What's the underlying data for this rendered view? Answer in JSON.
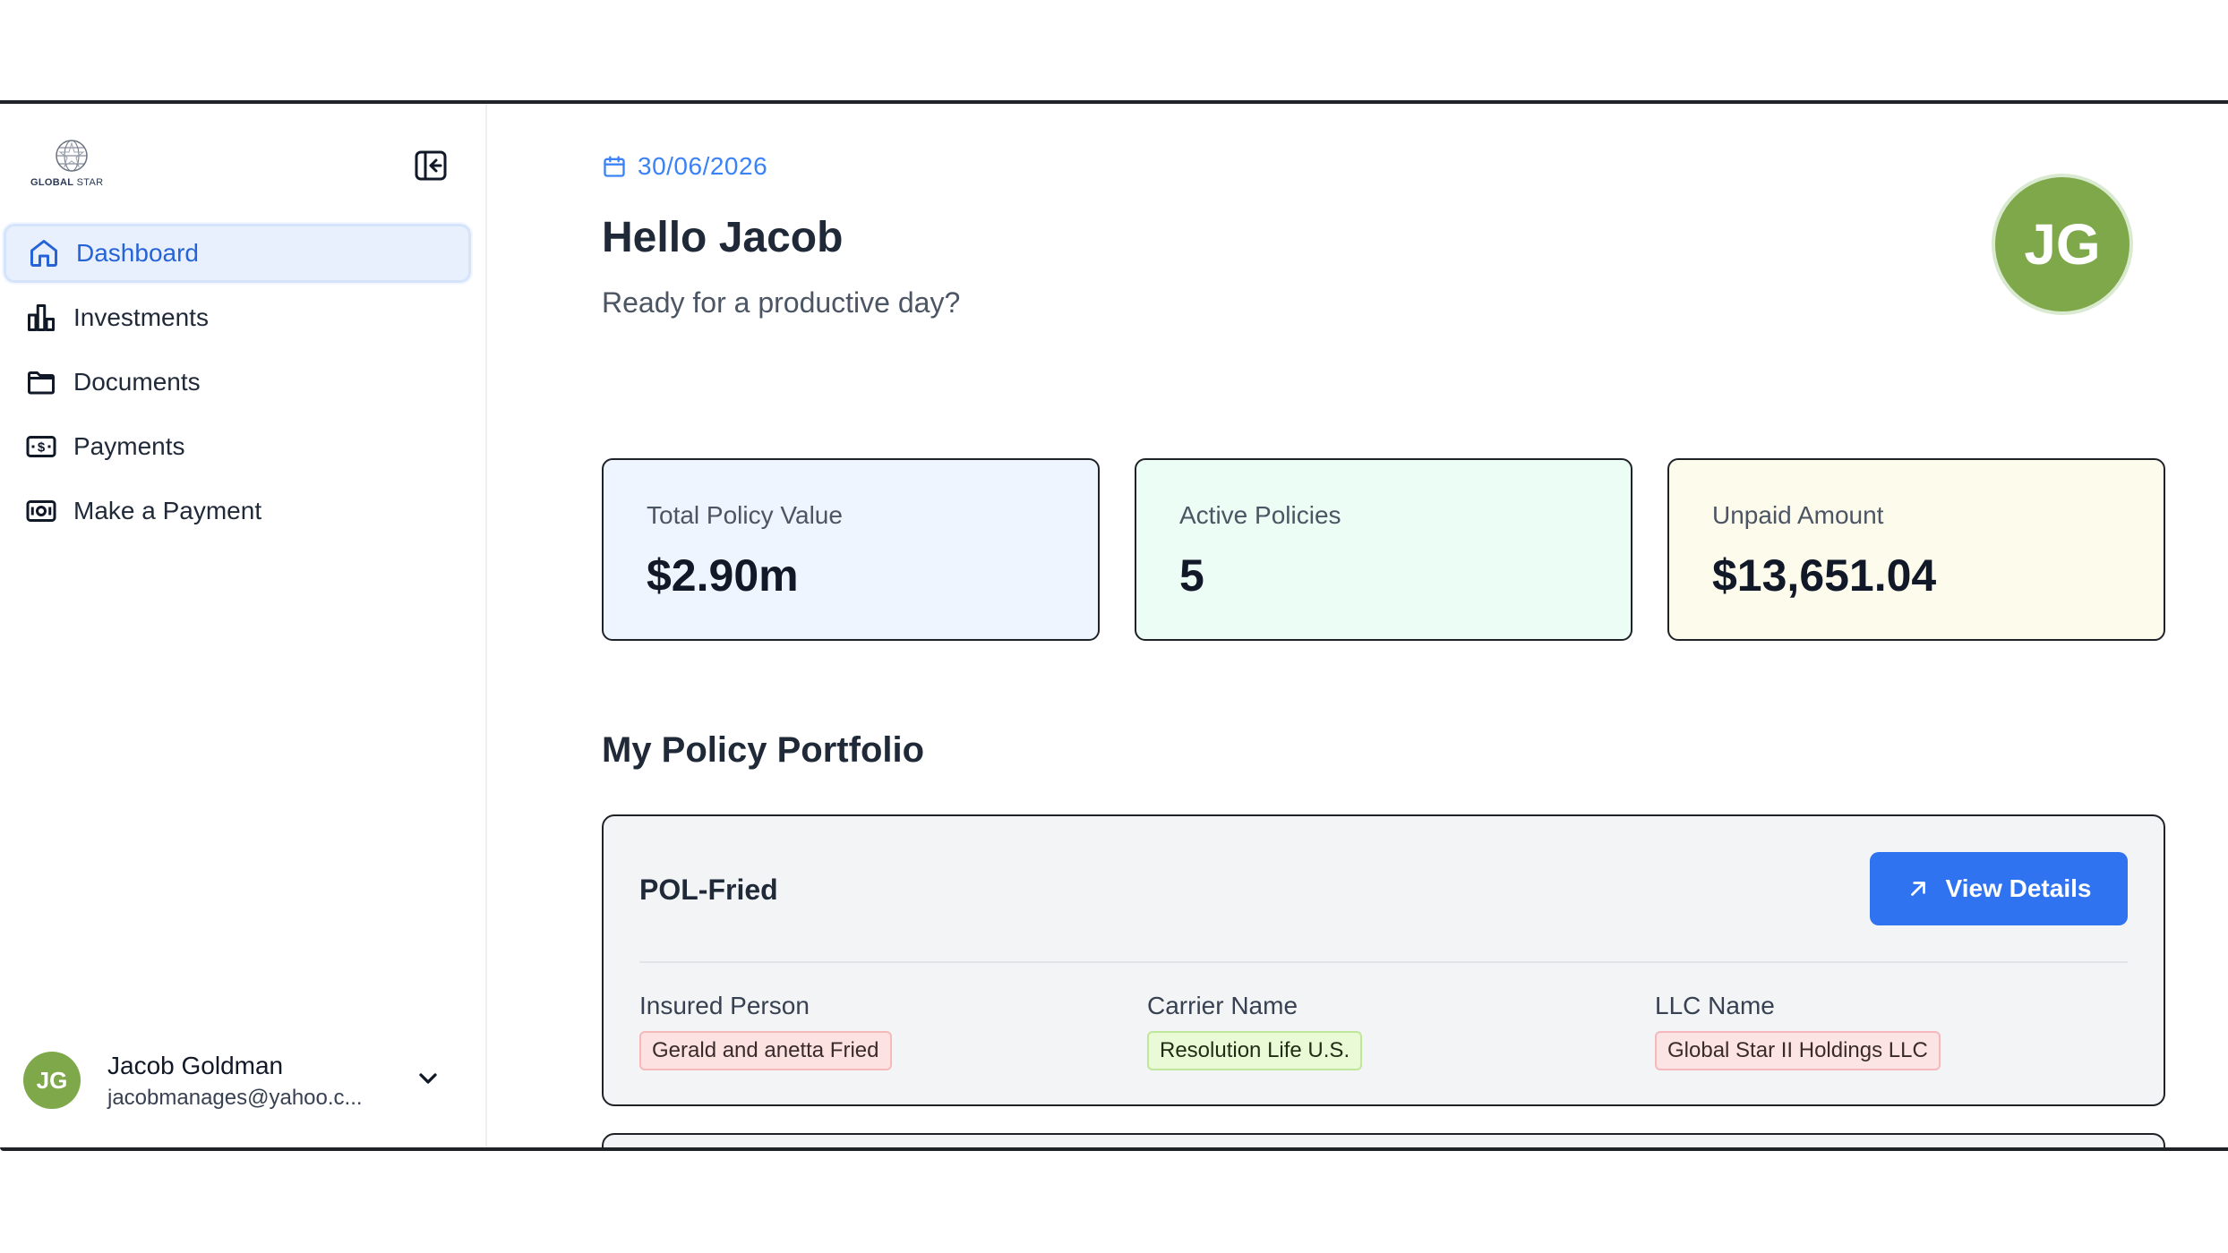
{
  "sidebar": {
    "logo": {
      "brand_bold": "GLOBAL",
      "brand_light": " STAR"
    },
    "items": [
      {
        "label": "Dashboard",
        "icon": "home-icon",
        "active": true
      },
      {
        "label": "Investments",
        "icon": "bar-chart-icon",
        "active": false
      },
      {
        "label": "Documents",
        "icon": "folder-icon",
        "active": false
      },
      {
        "label": "Payments",
        "icon": "dollar-card-icon",
        "active": false
      },
      {
        "label": "Make a Payment",
        "icon": "banknote-icon",
        "active": false
      }
    ],
    "user": {
      "initials": "JG",
      "name": "Jacob Goldman",
      "email": "jacobmanages@yahoo.c..."
    }
  },
  "header": {
    "date": "30/06/2026",
    "greeting": "Hello Jacob",
    "subtitle": "Ready for a productive day?",
    "avatar_initials": "JG"
  },
  "stats": [
    {
      "label": "Total Policy Value",
      "value": "$2.90m"
    },
    {
      "label": "Active Policies",
      "value": "5"
    },
    {
      "label": "Unpaid Amount",
      "value": "$13,651.04"
    }
  ],
  "portfolio": {
    "title": "My Policy Portfolio",
    "policies": [
      {
        "name": "POL-Fried",
        "button_label": "View Details",
        "fields": [
          {
            "label": "Insured Person",
            "value": "Gerald and anetta Fried"
          },
          {
            "label": "Carrier Name",
            "value": "Resolution Life U.S."
          },
          {
            "label": "LLC Name",
            "value": "Global Star II Holdings LLC"
          }
        ]
      }
    ]
  },
  "colors": {
    "accent": "#2f73f0",
    "active_nav_bg": "#e8f0fd",
    "avatar_bg": "#7fa84a",
    "stat_blue_bg": "#eff5fe",
    "stat_green_bg": "#ecfdf5",
    "stat_yellow_bg": "#fdfbec"
  }
}
